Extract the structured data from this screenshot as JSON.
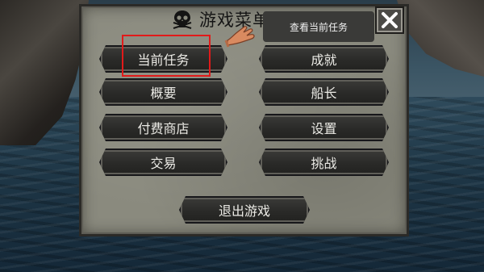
{
  "menu": {
    "title": "游戏菜单",
    "tooltip": "查看当前任务",
    "left_items": [
      "当前任务",
      "概要",
      "付费商店",
      "交易"
    ],
    "right_items": [
      "成就",
      "船长",
      "设置",
      "挑战"
    ],
    "exit_label": "退出游戏"
  },
  "icons": {
    "title": "skull-icon",
    "pointer": "pointing-hand-icon",
    "close": "close-icon"
  },
  "colors": {
    "panel": "#8a8a7e",
    "button": "#2a2a28",
    "button_text": "#ecebe6",
    "highlight": "#e11a1a",
    "tooltip_bg": "#3a3a38"
  }
}
